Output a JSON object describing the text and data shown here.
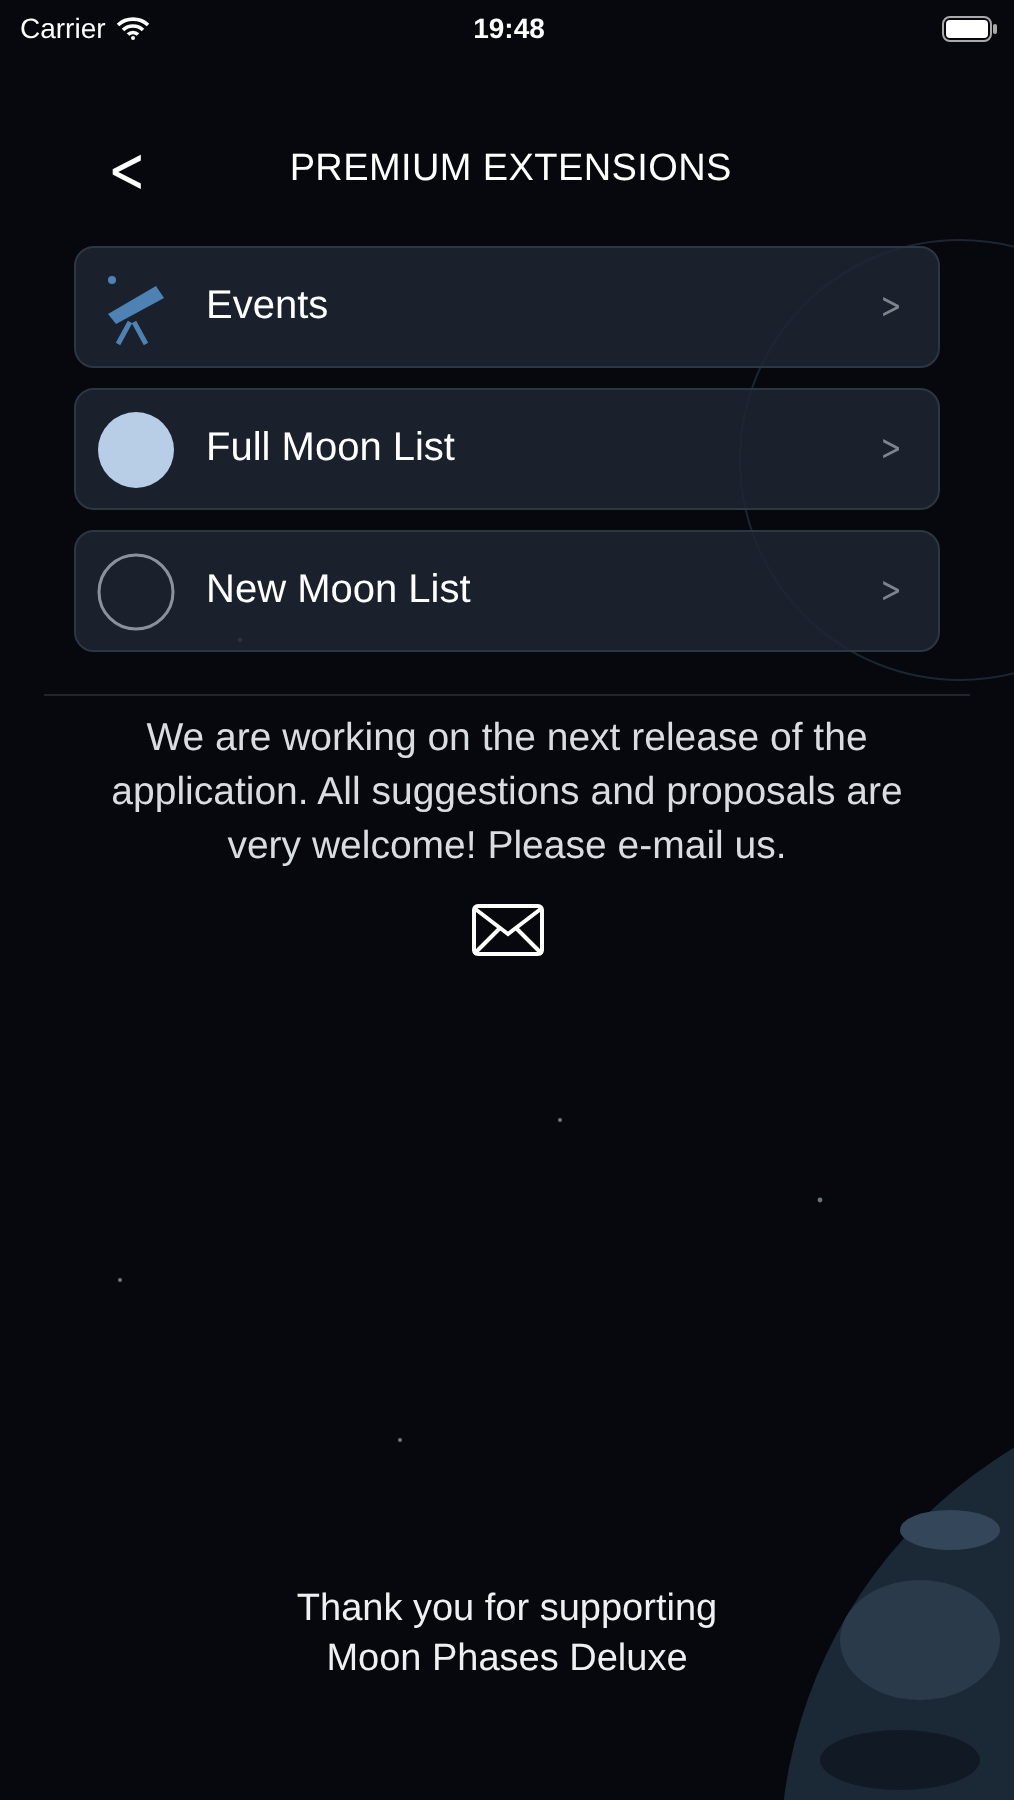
{
  "status_bar": {
    "carrier": "Carrier",
    "time": "19:48"
  },
  "nav": {
    "back": "<",
    "title": "PREMIUM EXTENSIONS"
  },
  "items": [
    {
      "kind": "telescope",
      "label": "Events",
      "chevron": ">"
    },
    {
      "kind": "full-moon",
      "label": "Full Moon List",
      "chevron": ">"
    },
    {
      "kind": "new-moon",
      "label": "New Moon List",
      "chevron": ">"
    }
  ],
  "message": "We are working on the next release of the application. All suggestions and proposals are very welcome! Please e-mail us.",
  "footer": [
    "Thank you for supporting",
    "Moon Phases Deluxe"
  ],
  "background": {
    "kind": "picture"
  }
}
